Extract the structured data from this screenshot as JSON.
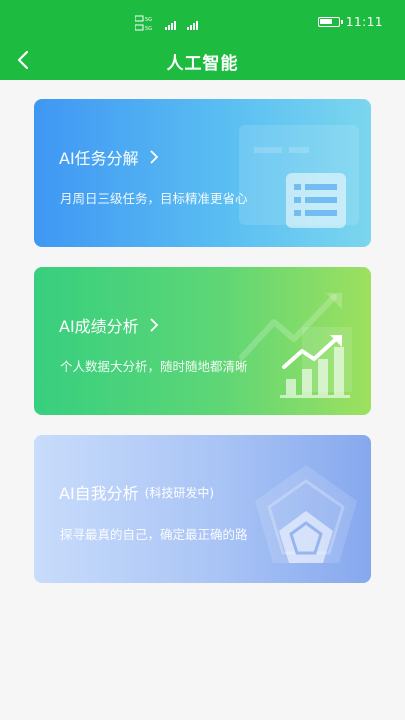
{
  "status": {
    "time": "11:11",
    "signal_text_1": "5G",
    "signal_text_2": "5G"
  },
  "header": {
    "title": "人工智能",
    "back_icon": "chevron-left-icon"
  },
  "cards": [
    {
      "title": "AI任务分解",
      "subtitle": "月周日三级任务，目标精准更省心",
      "icon": "task-list-icon"
    },
    {
      "title": "AI成绩分析",
      "subtitle": "个人数据大分析，随时随地都清晰",
      "icon": "growth-chart-icon"
    },
    {
      "title": "AI自我分析",
      "tag": "(科技研发中)",
      "subtitle": "探寻最真的自己，确定最正确的路",
      "icon": "pentagon-radar-icon"
    }
  ],
  "colors": {
    "primary": "#1dbb3f",
    "background": "#f6f6f6"
  }
}
